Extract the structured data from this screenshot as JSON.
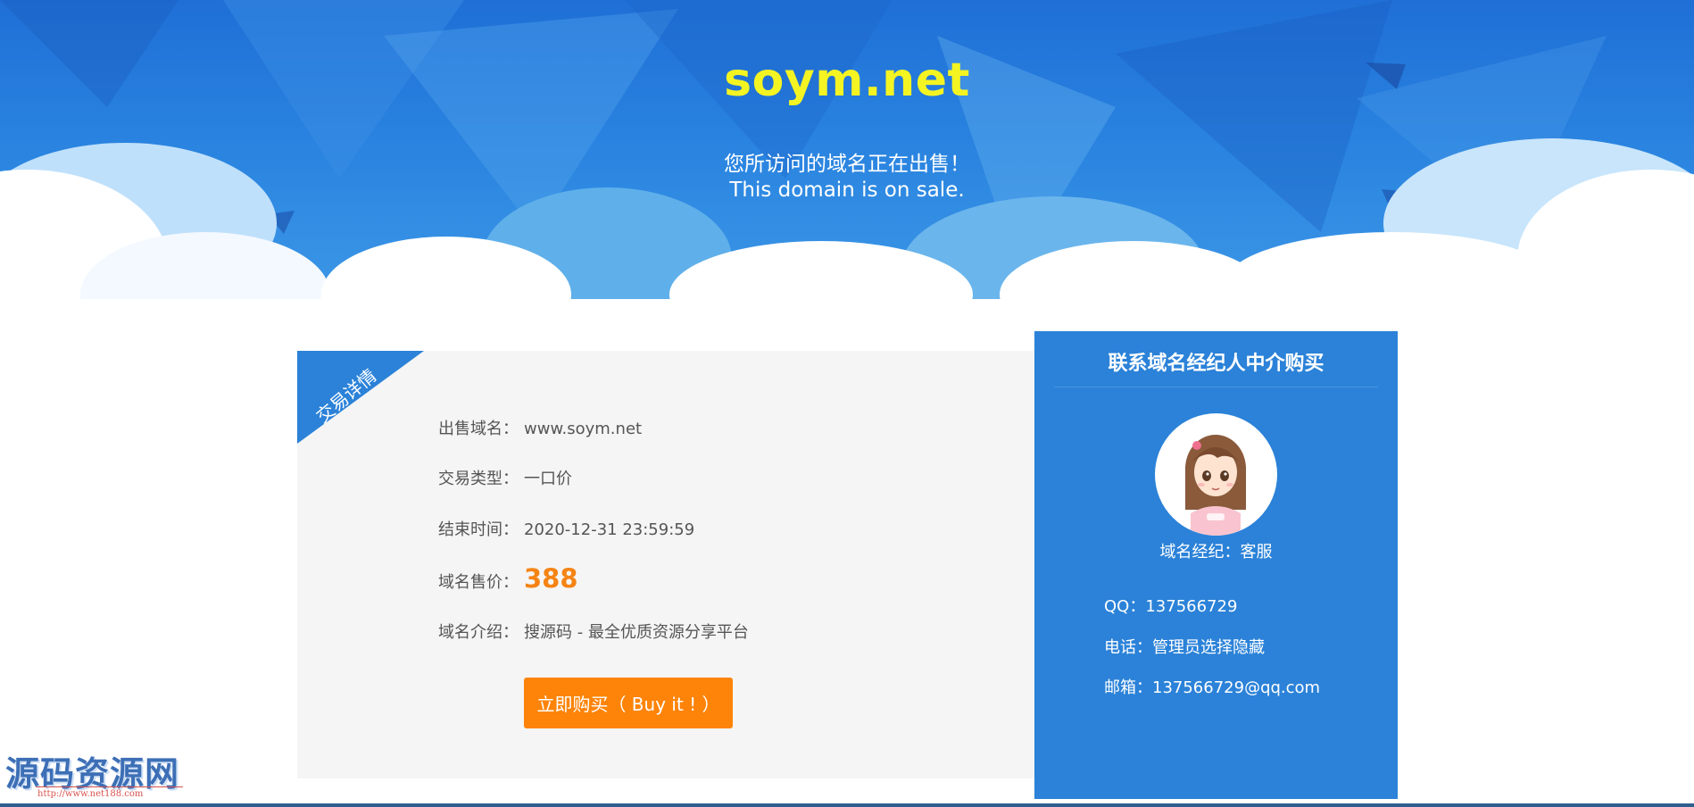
{
  "hero": {
    "title": "soym.net",
    "subtitle_cn": "您所访问的域名正在出售！",
    "subtitle_en": "This domain is on sale."
  },
  "detail": {
    "ribbon": "交易详情",
    "rows": [
      {
        "label": "出售域名：",
        "value": "www.soym.net"
      },
      {
        "label": "交易类型：",
        "value": "一口价"
      },
      {
        "label": "结束时间：",
        "value": "2020-12-31 23:59:59"
      },
      {
        "label": "域名售价：",
        "value": "388"
      },
      {
        "label": "域名介绍：",
        "value": "搜源码 - 最全优质资源分享平台"
      }
    ],
    "buy_button": "立即购买（ Buy it ! ）"
  },
  "broker": {
    "title": "联系域名经纪人中介购买",
    "name": "域名经纪：客服",
    "qq": "QQ：137566729",
    "phone": "电话：管理员选择隐藏",
    "email": "邮箱：137566729@qq.com"
  },
  "watermark": {
    "logo": "源码资源网",
    "url": "http://www.net188.com"
  },
  "colors": {
    "title_yellow": "#f4f422",
    "hero_blue": "#2a84e0",
    "panel_blue": "#2b82d8",
    "price_orange": "#f58415",
    "button_orange": "#fd8409"
  }
}
